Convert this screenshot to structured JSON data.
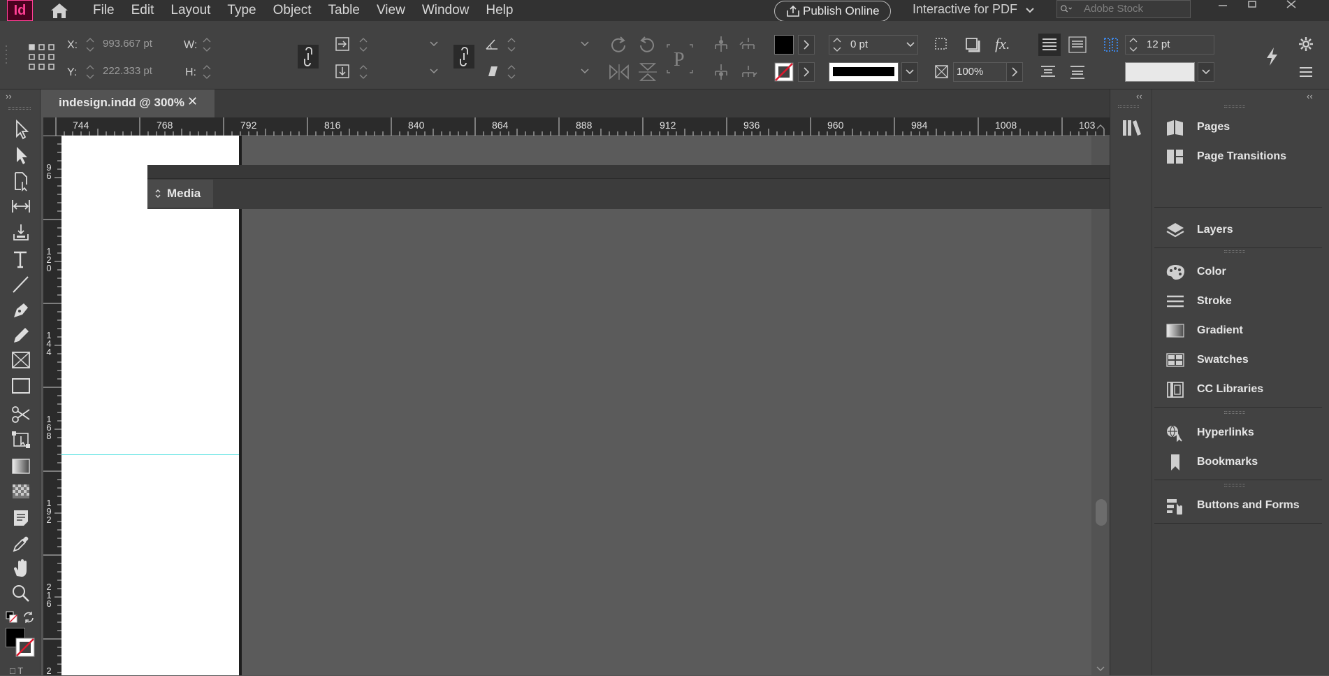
{
  "menubar": {
    "logo": "Id",
    "items": [
      "File",
      "Edit",
      "Layout",
      "Type",
      "Object",
      "Table",
      "View",
      "Window",
      "Help"
    ],
    "publish_label": "Publish Online",
    "workspace": "Interactive for PDF",
    "search_placeholder": "Adobe Stock"
  },
  "controls": {
    "x_label": "X:",
    "y_label": "Y:",
    "w_label": "W:",
    "h_label": "H:",
    "x_value": "993.667 pt",
    "y_value": "222.333 pt",
    "stroke_weight": "0 pt",
    "opacity": "100%",
    "column_gutter": "12 pt",
    "fill_color": "#000000"
  },
  "tools": [
    "selection-tool",
    "direct-selection-tool",
    "page-tool",
    "gap-tool",
    "content-collector-tool",
    "type-tool",
    "line-tool",
    "pen-tool",
    "pencil-tool",
    "rectangle-frame-tool",
    "rectangle-tool",
    "scissors-tool",
    "free-transform-tool",
    "gradient-swatch-tool",
    "gradient-feather-tool",
    "note-tool",
    "eyedropper-tool",
    "hand-tool",
    "zoom-tool"
  ],
  "document": {
    "tab_title": "indesign.indd @ 300%",
    "close_glyph": "✕"
  },
  "ruler": {
    "h_labels": [
      "744",
      "768",
      "792",
      "816",
      "840",
      "864",
      "888",
      "912",
      "936",
      "960",
      "984",
      "1008",
      "103"
    ],
    "v_labels": [
      "96",
      "120",
      "144",
      "168",
      "192",
      "216",
      "2"
    ]
  },
  "media_panel": {
    "title": "Media"
  },
  "dock": {
    "collapse_glyph": "‹‹",
    "expand_glyph": "››",
    "items": [
      {
        "label": "Pages",
        "icon": "pages-icon"
      },
      {
        "label": "Page Transitions",
        "icon": "page-transitions-icon"
      },
      {
        "label": "Layers",
        "icon": "layers-icon"
      },
      {
        "label": "Color",
        "icon": "color-icon"
      },
      {
        "label": "Stroke",
        "icon": "stroke-icon"
      },
      {
        "label": "Gradient",
        "icon": "gradient-icon"
      },
      {
        "label": "Swatches",
        "icon": "swatches-icon"
      },
      {
        "label": "CC Libraries",
        "icon": "cc-libraries-icon"
      },
      {
        "label": "Hyperlinks",
        "icon": "hyperlinks-icon"
      },
      {
        "label": "Bookmarks",
        "icon": "bookmarks-icon"
      },
      {
        "label": "Buttons and Forms",
        "icon": "buttons-forms-icon"
      }
    ]
  },
  "colors": {
    "accent": "#ff3f94",
    "guide": "#4fe0e0",
    "panel_bg": "#424242",
    "pasteboard": "#5b5b5b"
  }
}
